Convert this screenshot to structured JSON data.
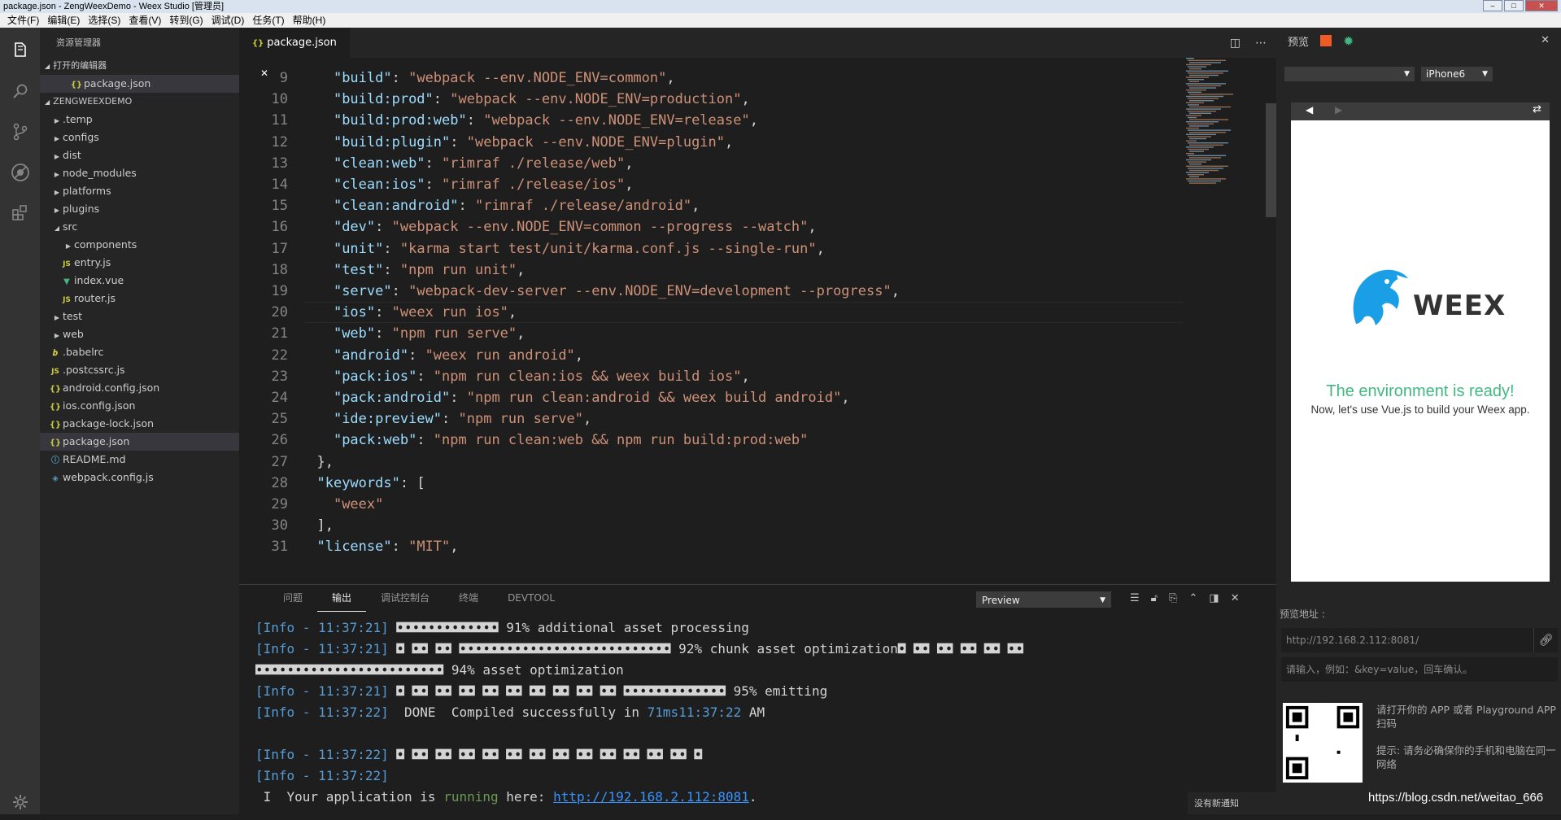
{
  "window": {
    "title": "package.json - ZengWeexDemo - Weex Studio [管理员]"
  },
  "menu": [
    "文件(F)",
    "编辑(E)",
    "选择(S)",
    "查看(V)",
    "转到(G)",
    "调试(D)",
    "任务(T)",
    "帮助(H)"
  ],
  "sidebar": {
    "title": "资源管理器",
    "open_editors_label": "打开的编辑器",
    "open_editor_file": "package.json",
    "project_label": "ZENGWEEXDEMO",
    "items": [
      {
        "label": ".temp",
        "type": "folder"
      },
      {
        "label": "configs",
        "type": "folder"
      },
      {
        "label": "dist",
        "type": "folder"
      },
      {
        "label": "node_modules",
        "type": "folder"
      },
      {
        "label": "platforms",
        "type": "folder"
      },
      {
        "label": "plugins",
        "type": "folder"
      },
      {
        "label": "src",
        "type": "folder-open"
      },
      {
        "label": "components",
        "type": "folder"
      },
      {
        "label": "entry.js",
        "type": "js"
      },
      {
        "label": "index.vue",
        "type": "vue"
      },
      {
        "label": "router.js",
        "type": "js"
      },
      {
        "label": "test",
        "type": "folder"
      },
      {
        "label": "web",
        "type": "folder"
      },
      {
        "label": ".babelrc",
        "type": "babel"
      },
      {
        "label": ".postcssrc.js",
        "type": "js"
      },
      {
        "label": "android.config.json",
        "type": "json"
      },
      {
        "label": "ios.config.json",
        "type": "json"
      },
      {
        "label": "package-lock.json",
        "type": "json"
      },
      {
        "label": "package.json",
        "type": "json"
      },
      {
        "label": "README.md",
        "type": "info"
      },
      {
        "label": "webpack.config.js",
        "type": "webpack"
      }
    ]
  },
  "editor": {
    "tab_label": "package.json",
    "lines": [
      {
        "n": "9",
        "k": "\"build\"",
        "v": "\"webpack --env.NODE_ENV=common\"",
        "t": ","
      },
      {
        "n": "10",
        "k": "\"build:prod\"",
        "v": "\"webpack --env.NODE_ENV=production\"",
        "t": ","
      },
      {
        "n": "11",
        "k": "\"build:prod:web\"",
        "v": "\"webpack --env.NODE_ENV=release\"",
        "t": ","
      },
      {
        "n": "12",
        "k": "\"build:plugin\"",
        "v": "\"webpack --env.NODE_ENV=plugin\"",
        "t": ","
      },
      {
        "n": "13",
        "k": "\"clean:web\"",
        "v": "\"rimraf ./release/web\"",
        "t": ","
      },
      {
        "n": "14",
        "k": "\"clean:ios\"",
        "v": "\"rimraf ./release/ios\"",
        "t": ","
      },
      {
        "n": "15",
        "k": "\"clean:android\"",
        "v": "\"rimraf ./release/android\"",
        "t": ","
      },
      {
        "n": "16",
        "k": "\"dev\"",
        "v": "\"webpack --env.NODE_ENV=common --progress --watch\"",
        "t": ","
      },
      {
        "n": "17",
        "k": "\"unit\"",
        "v": "\"karma start test/unit/karma.conf.js --single-run\"",
        "t": ","
      },
      {
        "n": "18",
        "k": "\"test\"",
        "v": "\"npm run unit\"",
        "t": ","
      },
      {
        "n": "19",
        "k": "\"serve\"",
        "v": "\"webpack-dev-server --env.NODE_ENV=development --progress\"",
        "t": ","
      },
      {
        "n": "20",
        "k": "\"ios\"",
        "v": "\"weex run ios\"",
        "t": ","
      },
      {
        "n": "21",
        "k": "\"web\"",
        "v": "\"npm run serve\"",
        "t": ","
      },
      {
        "n": "22",
        "k": "\"android\"",
        "v": "\"weex run android\"",
        "t": ","
      },
      {
        "n": "23",
        "k": "\"pack:ios\"",
        "v": "\"npm run clean:ios && weex build ios\"",
        "t": ","
      },
      {
        "n": "24",
        "k": "\"pack:android\"",
        "v": "\"npm run clean:android && weex build android\"",
        "t": ","
      },
      {
        "n": "25",
        "k": "\"ide:preview\"",
        "v": "\"npm run serve\"",
        "t": ","
      },
      {
        "n": "26",
        "k": "\"pack:web\"",
        "v": "\"npm run clean:web && npm run build:prod:web\"",
        "t": ""
      },
      {
        "n": "27",
        "k": "",
        "v": "",
        "t": "},"
      },
      {
        "n": "28",
        "k": "\"keywords\"",
        "v": "",
        "t": "["
      },
      {
        "n": "29",
        "k": "",
        "v": "\"weex\"",
        "t": ""
      },
      {
        "n": "30",
        "k": "",
        "v": "",
        "t": "],"
      },
      {
        "n": "31",
        "k": "\"license\"",
        "v": "\"MIT\"",
        "t": ","
      }
    ]
  },
  "panel": {
    "tabs": [
      "问题",
      "输出",
      "调试控制台",
      "终端",
      "DEVTOOL"
    ],
    "active_tab": "输出",
    "channel_select": "Preview",
    "output": {
      "l1_prefix": "[Info - 11:37:21]",
      "l1_text": " ◘◘◘◘◘◘◘◘◘◘◘◘◘ 91% additional asset processing",
      "l2_prefix": "[Info - 11:37:21]",
      "l2_text": " ◘ ◘◘ ◘◘ ◘◘◘◘◘◘◘◘◘◘◘◘◘◘◘◘◘◘◘◘◘◘◘◘◘◘◘ 92% chunk asset optimization◘ ◘◘ ◘◘ ◘◘ ◘◘ ◘◘",
      "l3_text": "◘◘◘◘◘◘◘◘◘◘◘◘◘◘◘◘◘◘◘◘◘◘◘◘ 94% asset optimization",
      "l4_prefix": "[Info - 11:37:21]",
      "l4_text": " ◘ ◘◘ ◘◘ ◘◘ ◘◘ ◘◘ ◘◘ ◘◘ ◘◘ ◘◘ ◘◘◘◘◘◘◘◘◘◘◘◘◘ 95% emitting",
      "l5_prefix": "[Info - 11:37:22]",
      "l5_text_a": "  DONE  Compiled successfully in ",
      "l5_time": "71ms11:37:22",
      "l5_text_b": " AM",
      "l7_prefix": "[Info - 11:37:22]",
      "l7_text": " ◘ ◘◘ ◘◘ ◘◘ ◘◘ ◘◘ ◘◘ ◘◘ ◘◘ ◘◘ ◘◘ ◘◘ ◘◘ ◘",
      "l8_prefix": "[Info - 11:37:22]",
      "l9_a": " I  Your application is ",
      "l9_running": "running",
      "l9_b": " here: ",
      "l9_url": "http://192.168.2.112:8081",
      "l9_c": "."
    }
  },
  "preview": {
    "title": "预览",
    "device_select": "iPhone6",
    "weex_wordmark": "WEEX",
    "ready_title": "The environment is ready!",
    "ready_subtitle": "Now, let's use Vue.js to build your Weex app.",
    "url_label": "预览地址 :",
    "url_value": "http://192.168.2.112:8081/",
    "param_placeholder": "请输入，例如：&key=value，回车确认。",
    "qr_hint": "请打开你的 APP 或者 Playground APP 扫码",
    "qr_tip": "提示: 请务必确保你的手机和电脑在同一网络"
  },
  "status": {
    "notification": "没有新通知",
    "watermark": "https://blog.csdn.net/weitao_666"
  },
  "colors": {
    "accent_green": "#41b883",
    "weex_blue": "#1a9fe6",
    "string": "#ce9178",
    "key": "#9cdcfe"
  }
}
